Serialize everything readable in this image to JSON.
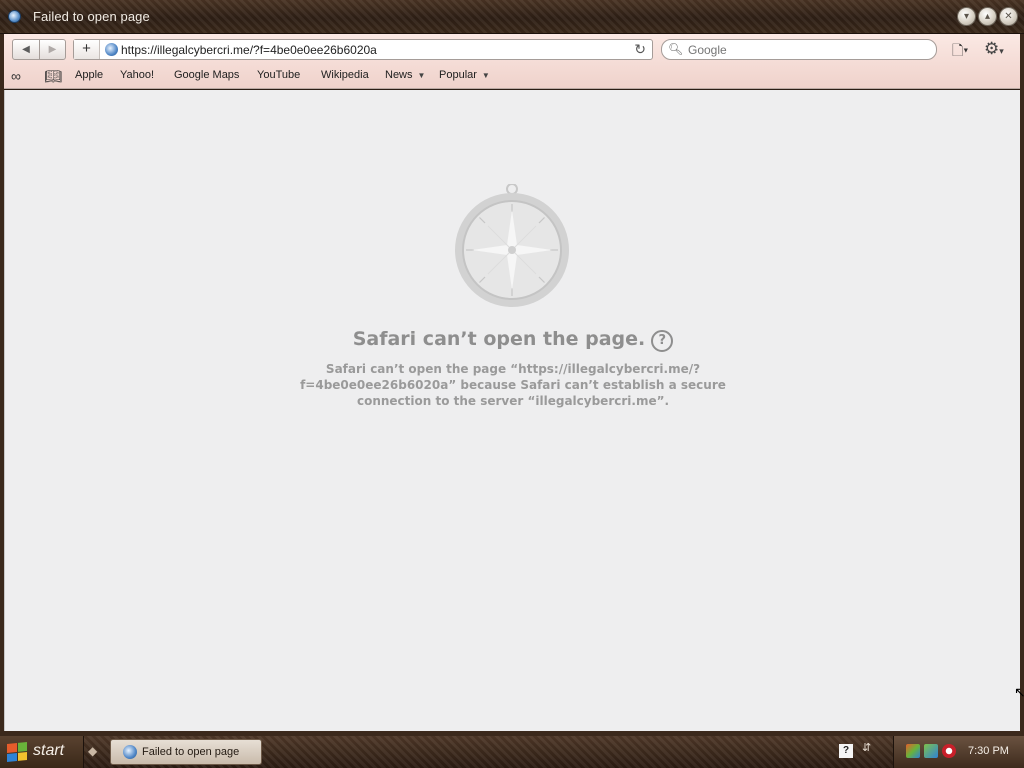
{
  "window": {
    "title": "Failed to open page"
  },
  "toolbar": {
    "back_icon": "◀",
    "forward_icon": "▶",
    "add_bookmark_icon": "+",
    "address": "https://illegalcybercri.me/?f=4be0e0ee26b6020a",
    "search_placeholder": "Google",
    "reload_icon": "↻"
  },
  "bookmarks": {
    "items": [
      {
        "label": "Apple"
      },
      {
        "label": "Yahoo!"
      },
      {
        "label": "Google Maps"
      },
      {
        "label": "YouTube"
      },
      {
        "label": "Wikipedia"
      },
      {
        "label": "News"
      },
      {
        "label": "Popular"
      }
    ]
  },
  "error": {
    "heading": "Safari can’t open the page.",
    "help_icon_label": "?",
    "message": "Safari can’t open the page “https://illegalcybercri.me/?f=4be0e0ee26b6020a” because Safari can’t establish a secure connection to the server “illegalcybercri.me”."
  },
  "taskbar": {
    "start_label": "start",
    "task_item_label": "Failed to open page",
    "clock": "7:30 PM",
    "help_label": "?"
  },
  "colors": {
    "content_bg": "#eeeeef",
    "error_text": "#8e8e8e",
    "toolbar_bg": "#f4dbd5",
    "frame": "#3b291c"
  }
}
